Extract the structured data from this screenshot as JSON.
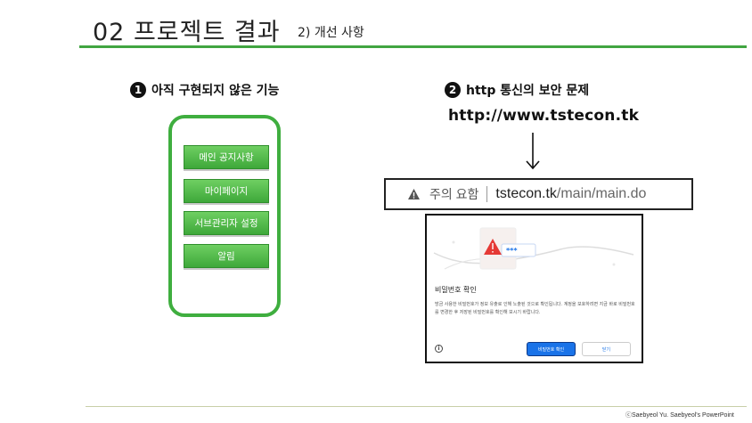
{
  "header": {
    "title": "02 프로젝트 결과",
    "subtitle": "2) 개선 사항"
  },
  "section1": {
    "number": "1",
    "title": "아직 구현되지 않은 기능",
    "menu": [
      "메인 공지사항",
      "마이페이지",
      "서브관리자 설정",
      "알림"
    ]
  },
  "section2": {
    "number": "2",
    "title": "http 통신의 보안 문제",
    "url": "http://www.tstecon.tk",
    "address_bar": {
      "warning": "주의 요함",
      "domain": "tstecon.tk",
      "path": "/main/main.do"
    },
    "dialog": {
      "art_text": "***",
      "title": "비밀번호 확인",
      "body": "방금 사용한 비밀번호가 정보 유출로 인해 노출된 것으로 확인됩니다. 계정을 보호하려면 지금 바로 비밀번호를 변경한 후 저장된 비밀번호를 확인해 보시기 바랍니다.",
      "confirm_label": "비밀번호 확인",
      "close_label": "닫기"
    }
  },
  "footer": {
    "copyright": "ⓒSaebyeol Yu. Saebyeol's PowerPoint"
  },
  "colors": {
    "accent_green": "#41a541",
    "button_blue": "#1a73e8",
    "warning_red": "#e53935"
  }
}
